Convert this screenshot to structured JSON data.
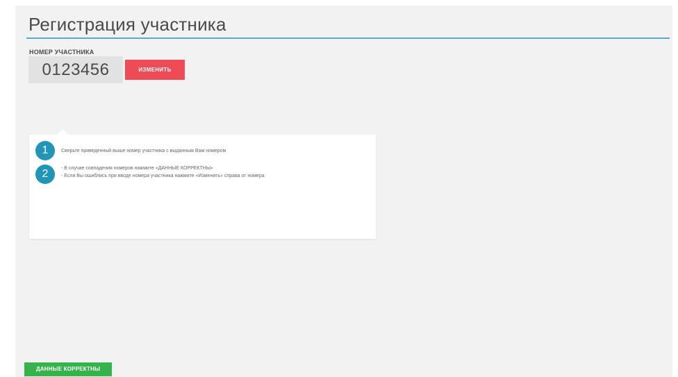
{
  "page": {
    "title": "Регистрация участника"
  },
  "participant": {
    "label": "НОМЕР УЧАСТНИКА",
    "number": "0123456",
    "change_label": "ИЗМЕНИТЬ"
  },
  "instructions": {
    "steps": [
      {
        "number": "1",
        "lines": [
          "Сверьте приведенный выше номер участника с выданным Вам номером"
        ]
      },
      {
        "number": "2",
        "lines": [
          "- В случае совпадения номеров нажмите «ДАННЫЕ КОРРЕКТНЫ»",
          "- Если Вы ошиблись при вводе номера участника нажмите «Изменить» справа от номера"
        ]
      }
    ]
  },
  "footer": {
    "confirm_label": "ДАННЫЕ КОРРЕКТНЫ"
  },
  "colors": {
    "accent_blue": "#1f95b7",
    "title_rule": "#5aa9c4",
    "change_button": "#ef4b56",
    "confirm_button": "#34b34a",
    "background": "#f2f2f2"
  }
}
